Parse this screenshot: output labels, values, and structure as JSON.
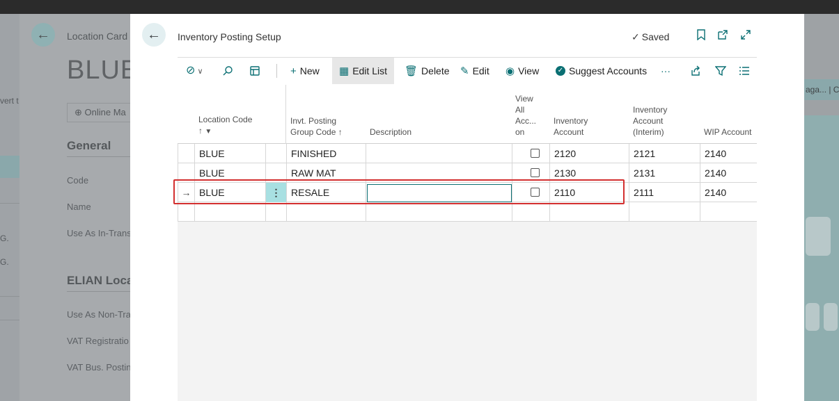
{
  "background": {
    "left_strip": {
      "texts": [
        "vert t",
        "G.",
        "G."
      ]
    },
    "page": {
      "title_small": "Location Card",
      "title_big": "BLUE",
      "online_button": "Online Ma",
      "general_section": "General",
      "fields": [
        "Code",
        "Name",
        "Use As In-Trans"
      ],
      "second_section": "ELIAN Loca",
      "fields2": [
        "Use As Non-Tra",
        "VAT Registratio",
        "VAT Bus. Postin"
      ]
    },
    "right_strip": {
      "tag": "aga... | C"
    }
  },
  "modal": {
    "title": "Inventory Posting Setup",
    "saved_label": "Saved",
    "header_icons": [
      "bookmark-icon",
      "open-new-window-icon",
      "expand-icon"
    ]
  },
  "toolbar": {
    "new_label": "New",
    "edit_list_label": "Edit List",
    "delete_label": "Delete",
    "edit_label": "Edit",
    "view_label": "View",
    "suggest_label": "Suggest Accounts",
    "more_label": "···"
  },
  "grid": {
    "columns": {
      "location_code": [
        "Location Code",
        "↑"
      ],
      "posting_group": [
        "Invt. Posting",
        "Group Code ↑"
      ],
      "description": "Description",
      "view_all": [
        "View",
        "All",
        "Acc...",
        "on"
      ],
      "inventory_account": [
        "Inventory",
        "Account"
      ],
      "inventory_interim": [
        "Inventory",
        "Account",
        "(Interim)"
      ],
      "wip_account": "WIP Account"
    },
    "rows": [
      {
        "location": "BLUE",
        "group": "FINISHED",
        "description": "",
        "view_all": false,
        "inv": "2120",
        "interim": "2121",
        "wip": "2140"
      },
      {
        "location": "BLUE",
        "group": "RAW MAT",
        "description": "",
        "view_all": false,
        "inv": "2130",
        "interim": "2131",
        "wip": "2140"
      },
      {
        "location": "BLUE",
        "group": "RESALE",
        "description": "",
        "view_all": false,
        "inv": "2110",
        "interim": "2111",
        "wip": "2140"
      }
    ],
    "current_row_marker": "→",
    "row_menu": "⋮"
  },
  "colors": {
    "accent": "#0a6f73",
    "highlight_border": "#d32f2f",
    "row_menu_bg": "#a8e0e2"
  }
}
